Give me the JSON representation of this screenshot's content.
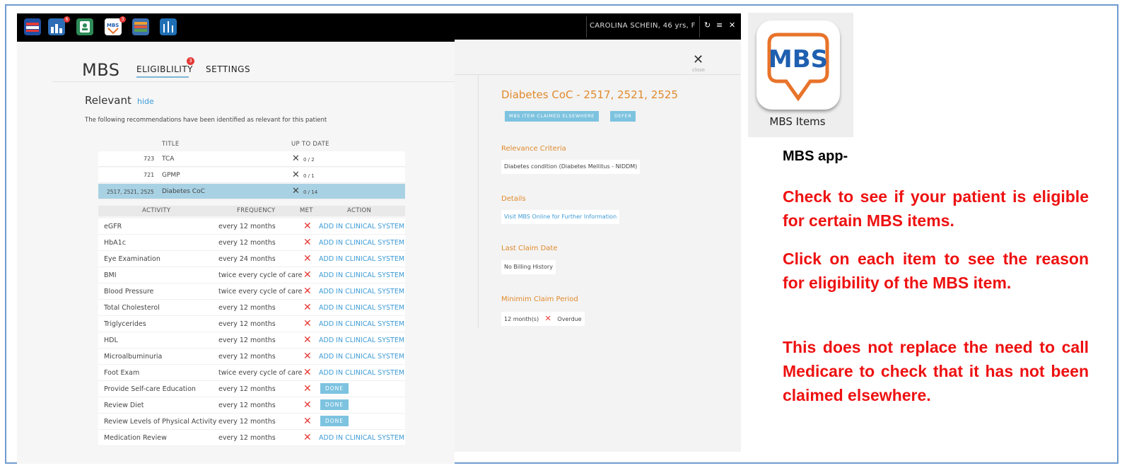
{
  "left_panel": {
    "module_title": "MBS",
    "tabs": [
      {
        "label": "ELIGIBLILITY",
        "badge": "3"
      },
      {
        "label": "SETTINGS"
      }
    ],
    "toolbar_badges": {
      "app2": "6",
      "app4": "3"
    },
    "section_title": "Relevant",
    "hide_link": "hide",
    "description": "The following recommendations have been identified as relevant for this patient",
    "table_headers": {
      "title": "TITLE",
      "up_to_date": "UP TO DATE"
    },
    "items": [
      {
        "code": "723",
        "title": "TCA",
        "status": "0 / 2"
      },
      {
        "code": "721",
        "title": "GPMP",
        "status": "0 / 1"
      },
      {
        "code": "2517, 2521, 2525",
        "title": "Diabetes CoC",
        "status": "0 / 14",
        "selected": true
      }
    ],
    "activity_headers": {
      "activity": "ACTIVITY",
      "frequency": "FREQUENCY",
      "met": "MET",
      "action": "ACTION"
    },
    "activities": [
      {
        "activity": "eGFR",
        "frequency": "every 12 months",
        "action": "ADD IN CLINICAL SYSTEM"
      },
      {
        "activity": "HbA1c",
        "frequency": "every 12 months",
        "action": "ADD IN CLINICAL SYSTEM"
      },
      {
        "activity": "Eye Examination",
        "frequency": "every 24 months",
        "action": "ADD IN CLINICAL SYSTEM"
      },
      {
        "activity": "BMI",
        "frequency": "twice every cycle of care",
        "action": "ADD IN CLINICAL SYSTEM"
      },
      {
        "activity": "Blood Pressure",
        "frequency": "twice every cycle of care",
        "action": "ADD IN CLINICAL SYSTEM"
      },
      {
        "activity": "Total Cholesterol",
        "frequency": "every 12 months",
        "action": "ADD IN CLINICAL SYSTEM"
      },
      {
        "activity": "Triglycerides",
        "frequency": "every 12 months",
        "action": "ADD IN CLINICAL SYSTEM"
      },
      {
        "activity": "HDL",
        "frequency": "every 12 months",
        "action": "ADD IN CLINICAL SYSTEM"
      },
      {
        "activity": "Microalbuminuria",
        "frequency": "every 12 months",
        "action": "ADD IN CLINICAL SYSTEM"
      },
      {
        "activity": "Foot Exam",
        "frequency": "twice every cycle of care",
        "action": "ADD IN CLINICAL SYSTEM"
      },
      {
        "activity": "Provide Self-care Education",
        "frequency": "every 12 months",
        "done": "DONE"
      },
      {
        "activity": "Review Diet",
        "frequency": "every 12 months",
        "done": "DONE"
      },
      {
        "activity": "Review Levels of Physical Activity",
        "frequency": "every 12 months",
        "done": "DONE"
      },
      {
        "activity": "Medication Review",
        "frequency": "every 12 months",
        "action": "ADD IN CLINICAL SYSTEM"
      }
    ]
  },
  "detail_panel": {
    "patient": "CAROLINA SCHEIN, 46 yrs, F",
    "close_label": "close",
    "title": "Diabetes CoC - 2517, 2521, 2525",
    "pills": [
      "MBS ITEM CLAIMED ELSEWHERE",
      "DEFER"
    ],
    "relevance_label": "Relevance Criteria",
    "relevance_value": "Diabetes condition (Diabetes Mellitus - NIDDM)",
    "details_label": "Details",
    "details_link": "Visit MBS Online for Further Information",
    "last_claim_label": "Last Claim Date",
    "last_claim_value": "No Billing History",
    "min_period_label": "Minimim Claim Period",
    "min_period_value": "12 month(s)",
    "min_period_status": "Overdue"
  },
  "logo_card": {
    "logo_text": "MBS",
    "caption": "MBS Items"
  },
  "annotation": {
    "heading": "MBS app-",
    "paragraphs": [
      "Check to see if your patient is eligible for certain MBS items.",
      "Click on each item to see the reason for eligibility of the MBS item.",
      "This does not replace the need to call Medicare to check that it has not been claimed elsewhere."
    ]
  },
  "colors": {
    "accent_blue": "#3d9bd6",
    "accent_orange": "#e08a2c",
    "alert_red": "#ee1111",
    "selected_row": "#a8d2e4"
  }
}
